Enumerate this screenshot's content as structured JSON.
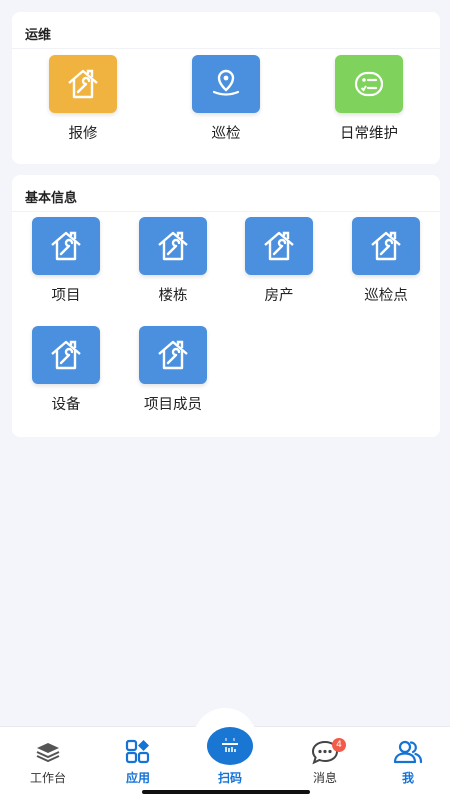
{
  "ops": {
    "title": "运维",
    "items": [
      {
        "label": "报修",
        "icon": "house-wrench-icon",
        "color": "#f0b33f"
      },
      {
        "label": "巡检",
        "icon": "location-pin-icon",
        "color": "#4a90de"
      },
      {
        "label": "日常维护",
        "icon": "checklist-icon",
        "color": "#7fd25c"
      }
    ]
  },
  "basic": {
    "title": "基本信息",
    "items": [
      {
        "label": "项目",
        "icon": "house-wrench-icon"
      },
      {
        "label": "楼栋",
        "icon": "house-wrench-icon"
      },
      {
        "label": "房产",
        "icon": "house-wrench-icon"
      },
      {
        "label": "巡检点",
        "icon": "house-wrench-icon"
      },
      {
        "label": "设备",
        "icon": "house-wrench-icon"
      },
      {
        "label": "项目成员",
        "icon": "house-wrench-icon"
      }
    ]
  },
  "tabbar": {
    "items": [
      {
        "label": "工作台",
        "icon": "layers-icon"
      },
      {
        "label": "应用",
        "icon": "apps-grid-icon",
        "active": true
      },
      {
        "label": "扫码",
        "icon": "scan-icon",
        "active": true
      },
      {
        "label": "消息",
        "icon": "chat-bubble-icon",
        "badge": "4"
      },
      {
        "label": "我",
        "icon": "users-icon",
        "active": true
      }
    ]
  },
  "colors": {
    "accent": "#1976d2",
    "badge": "#f25a4a"
  }
}
